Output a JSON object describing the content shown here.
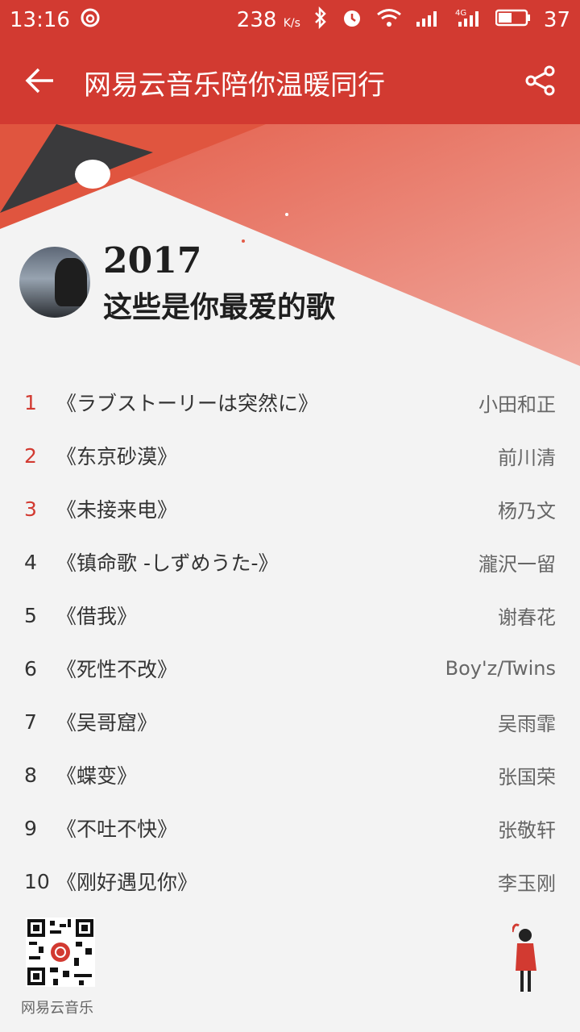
{
  "status_bar": {
    "time": "13:16",
    "speed": "238",
    "speed_unit": "K/s",
    "battery_level": "37",
    "icons": [
      "netease-logo-icon",
      "bluetooth-icon",
      "alarm-icon",
      "wifi-icon",
      "signal-icon",
      "4g-signal-icon",
      "battery-icon"
    ]
  },
  "app_bar": {
    "back_icon": "back-arrow-icon",
    "title": "网易云音乐陪你温暖同行",
    "share_icon": "share-icon"
  },
  "header": {
    "year": "2017",
    "headline": "这些是你最爱的歌"
  },
  "songs": [
    {
      "rank": "1",
      "title": "《ラブストーリーは突然に》",
      "artist": "小田和正"
    },
    {
      "rank": "2",
      "title": "《东京砂漠》",
      "artist": "前川清"
    },
    {
      "rank": "3",
      "title": "《未接来电》",
      "artist": "杨乃文"
    },
    {
      "rank": "4",
      "title": "《镇命歌 -しずめうた-》",
      "artist": "瀧沢一留"
    },
    {
      "rank": "5",
      "title": "《借我》",
      "artist": "谢春花"
    },
    {
      "rank": "6",
      "title": "《死性不改》",
      "artist": "Boy'z/Twins"
    },
    {
      "rank": "7",
      "title": "《吴哥窟》",
      "artist": "吴雨霏"
    },
    {
      "rank": "8",
      "title": "《蝶变》",
      "artist": "张国荣"
    },
    {
      "rank": "9",
      "title": "《不吐不快》",
      "artist": "张敬轩"
    },
    {
      "rank": "10",
      "title": "《刚好遇见你》",
      "artist": "李玉刚"
    }
  ],
  "footer": {
    "qr_label": "网易云音乐"
  },
  "colors": {
    "brand_red": "#d23a31",
    "text_dark": "#333333"
  }
}
